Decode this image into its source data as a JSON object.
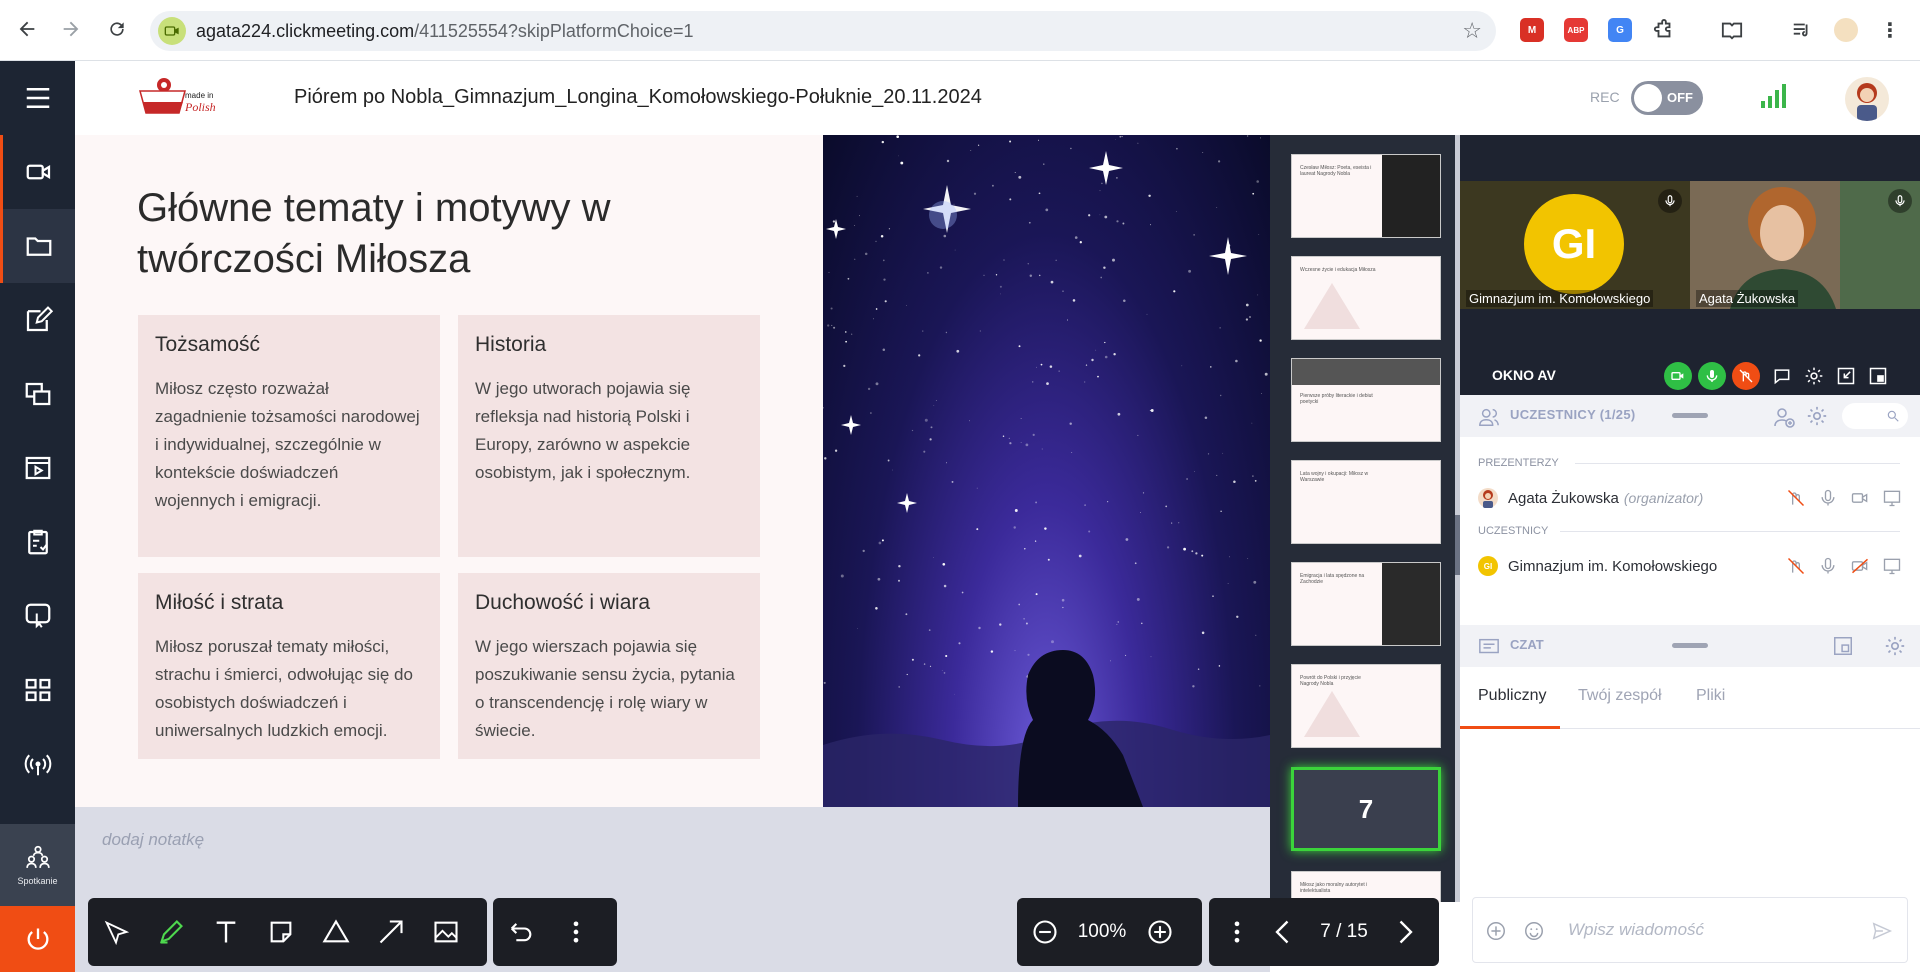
{
  "browser": {
    "url_host": "agata224.clickmeeting.com",
    "url_path": "/411525554?skipPlatformChoice=1",
    "extensions": [
      {
        "name": "gmail-extension-icon",
        "label": "M",
        "color": "#d93025"
      },
      {
        "name": "adblock-icon",
        "label": "ABP",
        "color": "#e53935"
      },
      {
        "name": "google-translate-icon",
        "label": "G",
        "color": "#4285f4"
      }
    ]
  },
  "sidebar": {
    "meeting_label": "Spotkanie"
  },
  "header": {
    "title": "Piórem po Nobla_Gimnazjum_Longina_Komołowskiego-Połuknie_20.11.2024",
    "rec_label": "REC",
    "rec_state": "OFF",
    "logo_text": "made in Polish"
  },
  "slide": {
    "title": "Główne tematy i motywy w twórczości Miłosza",
    "cards": [
      {
        "heading": "Tożsamość",
        "body": "Miłosz często rozważał zagadnienie tożsamości narodowej i indywidualnej, szczególnie w kontekście doświadczeń wojennych i emigracji."
      },
      {
        "heading": "Historia",
        "body": "W jego utworach pojawia się refleksja nad historią Polski i Europy, zarówno w aspekcie osobistym, jak i społecznym."
      },
      {
        "heading": "Miłość i strata",
        "body": "Miłosz poruszał tematy miłości, strachu i śmierci, odwołując się do osobistych doświadczeń i uniwersalnych ludzkich emocji."
      },
      {
        "heading": "Duchowość i wiara",
        "body": "W jego wierszach pojawia się poszukiwanie sensu życia, pytania o transcendencję i rolę wiary w świecie."
      }
    ],
    "note_placeholder": "dodaj notatkę"
  },
  "thumbnails": [
    {
      "title": "Czesław Miłosz: Poeta, eseista i laureat Nagrody Nobla"
    },
    {
      "title": "Wczesne życie i edukacja Miłosza"
    },
    {
      "title": "Pierwsze próby literackie i debiut poetycki"
    },
    {
      "title": "Lata wojny i okupacji: Miłosz w Warszawie"
    },
    {
      "title": "Emigracja i lata spędzone na Zachodzie"
    },
    {
      "title": "Powrót do Polski i przyjęcie Nagrody Nobla"
    },
    {
      "title": "",
      "number": "7"
    },
    {
      "title": "Miłosz jako moralny autorytet i intelektualista"
    }
  ],
  "toolbar": {
    "zoom": "100%",
    "page": "7 / 15"
  },
  "av_window": {
    "label": "OKNO AV",
    "tiles": [
      {
        "initials": "GI",
        "name": "Gimnazjum im. Komołowskiego"
      },
      {
        "name": "Agata Żukowska"
      }
    ]
  },
  "participants": {
    "title": "UCZESTNICY (1/25)",
    "presenters_label": "PREZENTERZY",
    "attendees_label": "UCZESTNICY",
    "presenters": [
      {
        "name": "Agata Żukowska",
        "role": "(organizator)"
      }
    ],
    "attendees": [
      {
        "name": "Gimnazjum im. Komołowskiego",
        "initials": "GI"
      }
    ]
  },
  "chat": {
    "title": "CZAT",
    "tabs": [
      "Publiczny",
      "Twój zespół",
      "Pliki"
    ],
    "input_placeholder": "Wpisz wiadomość"
  },
  "colors": {
    "accent": "#f04d14",
    "active_green": "#3bd43b",
    "gi_yellow": "#f2c400"
  }
}
